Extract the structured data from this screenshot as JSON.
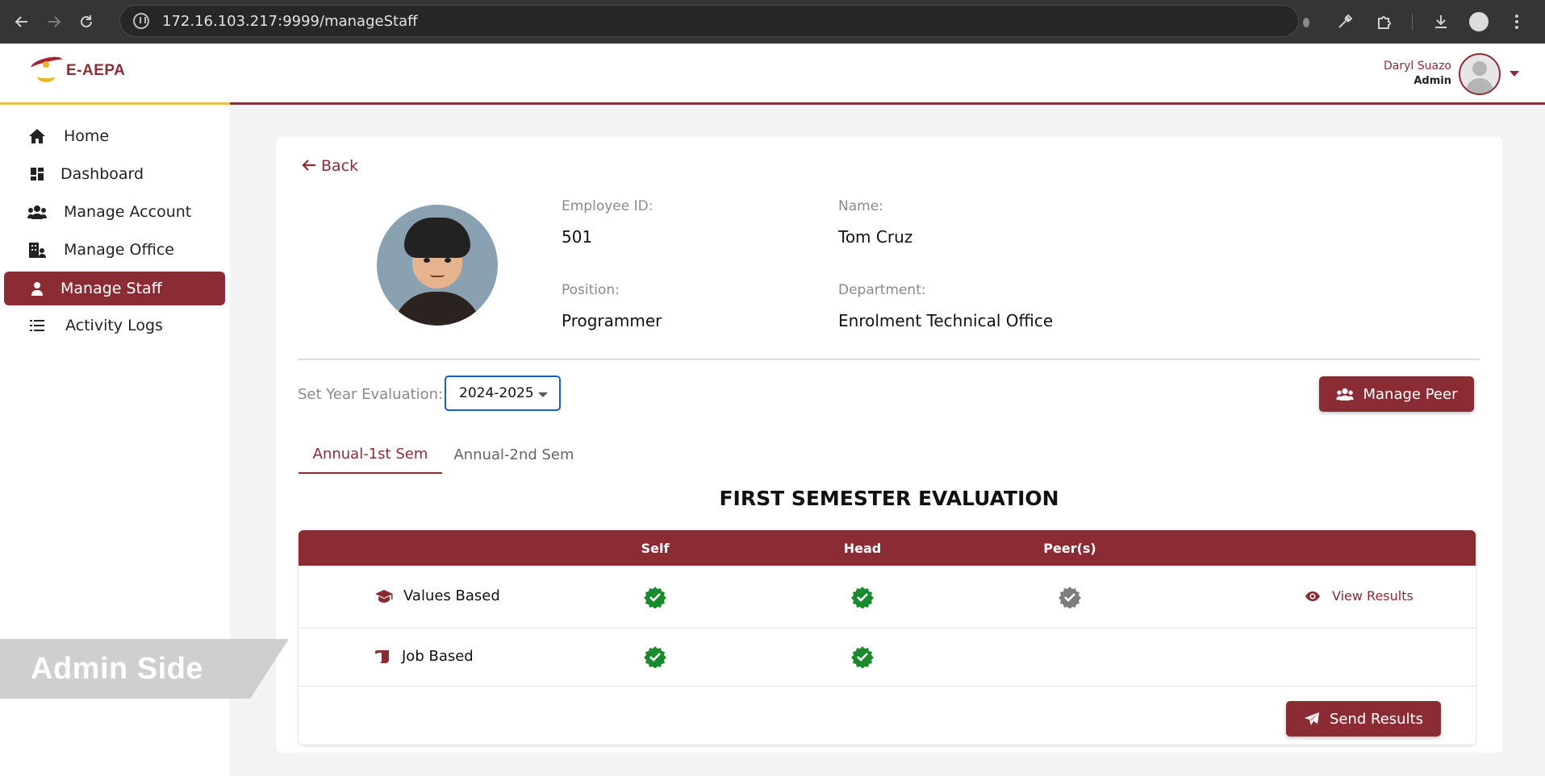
{
  "browser": {
    "url": "172.16.103.217:9999/manageStaff"
  },
  "header": {
    "logo_text": "E-AEPA",
    "user_name": "Daryl Suazo",
    "user_role": "Admin"
  },
  "sidebar": {
    "items": [
      {
        "label": "Home",
        "icon": "home-icon"
      },
      {
        "label": "Dashboard",
        "icon": "dashboard-icon"
      },
      {
        "label": "Manage Account",
        "icon": "users-icon"
      },
      {
        "label": "Manage Office",
        "icon": "office-icon"
      },
      {
        "label": "Manage Staff",
        "icon": "user-icon",
        "active": true
      },
      {
        "label": "Activity Logs",
        "icon": "list-icon"
      }
    ]
  },
  "main": {
    "back_label": "Back",
    "employee": {
      "id_label": "Employee ID:",
      "id_value": "501",
      "name_label": "Name:",
      "name_value": "Tom Cruz",
      "position_label": "Position:",
      "position_value": "Programmer",
      "department_label": "Department:",
      "department_value": "Enrolment Technical Office"
    },
    "year_label": "Set Year Evaluation:",
    "year_value": "2024-2025",
    "manage_peer_label": "Manage Peer",
    "tabs": [
      {
        "label": "Annual-1st Sem",
        "active": true
      },
      {
        "label": "Annual-2nd Sem",
        "active": false
      }
    ],
    "section_title": "FIRST SEMESTER EVALUATION",
    "table": {
      "headers": [
        "Self",
        "Head",
        "Peer(s)"
      ],
      "rows": [
        {
          "label": "Values Based",
          "icon": "graduation-cap-icon",
          "self": "done",
          "head": "done",
          "peers": "pending",
          "action": "View Results"
        },
        {
          "label": "Job Based",
          "icon": "scroll-icon",
          "self": "done",
          "head": "done",
          "peers": "",
          "action": ""
        }
      ]
    },
    "send_results_label": "Send Results"
  },
  "overlay": {
    "watermark": "Admin Side"
  },
  "colors": {
    "brand": "#8b2c35",
    "accent_yellow": "#e8c33a",
    "check_green": "#1a8a2e",
    "check_gray": "#7d7d7d",
    "focus_blue": "#1a5cc8"
  }
}
